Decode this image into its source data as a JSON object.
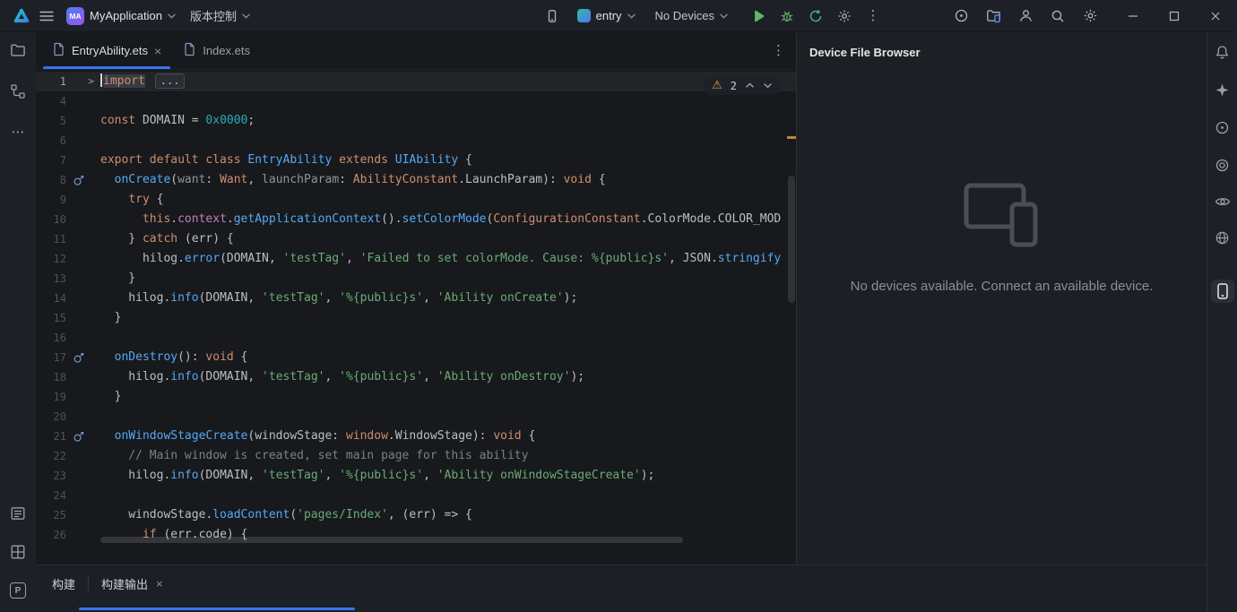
{
  "titlebar": {
    "project_badge": "MA",
    "project_name": "MyApplication",
    "vcs_label": "版本控制",
    "run_config_label": "entry",
    "device_selector_label": "No Devices"
  },
  "editor_tabs": {
    "tabs": [
      {
        "label": "EntryAbility.ets",
        "active": true
      },
      {
        "label": "Index.ets",
        "active": false
      }
    ]
  },
  "editor": {
    "inspection": {
      "warning_count": "2"
    },
    "token_colors": {
      "def": "#bcbec4",
      "kw": "#cf8e6d",
      "fn": "#56a8f5",
      "cls": "#56a8f5",
      "typ": "#cf8e6d",
      "str": "#6aab73",
      "num": "#29abb7",
      "cmt": "#7a8089",
      "fld": "#c77dbb",
      "prm": "#8f949d",
      "fold": "#b6bac2"
    },
    "lines": [
      {
        "n": "1",
        "caret": true,
        "fold": true,
        "tokens": [
          [
            "kw",
            "import",
            "hl"
          ],
          [
            "def",
            " "
          ],
          [
            "fold",
            "..."
          ]
        ]
      },
      {
        "n": "4",
        "tokens": []
      },
      {
        "n": "5",
        "tokens": [
          [
            "kw",
            "const"
          ],
          [
            "def",
            " DOMAIN = "
          ],
          [
            "num",
            "0x0000"
          ],
          [
            "def",
            ";"
          ]
        ]
      },
      {
        "n": "6",
        "tokens": []
      },
      {
        "n": "7",
        "tokens": [
          [
            "kw",
            "export default class "
          ],
          [
            "cls",
            "EntryAbility"
          ],
          [
            "kw",
            " extends "
          ],
          [
            "cls",
            "UIAbility"
          ],
          [
            "def",
            " {"
          ]
        ]
      },
      {
        "n": "8",
        "gutter": "override",
        "tokens": [
          [
            "def",
            "  "
          ],
          [
            "fn",
            "onCreate"
          ],
          [
            "def",
            "("
          ],
          [
            "prm",
            "want"
          ],
          [
            "def",
            ": "
          ],
          [
            "typ",
            "Want"
          ],
          [
            "def",
            ", "
          ],
          [
            "prm",
            "launchParam"
          ],
          [
            "def",
            ": "
          ],
          [
            "typ",
            "AbilityConstant"
          ],
          [
            "def",
            ".LaunchParam): "
          ],
          [
            "kw",
            "void"
          ],
          [
            "def",
            " {"
          ]
        ]
      },
      {
        "n": "9",
        "tokens": [
          [
            "def",
            "    "
          ],
          [
            "kw",
            "try"
          ],
          [
            "def",
            " {"
          ]
        ]
      },
      {
        "n": "10",
        "tokens": [
          [
            "def",
            "      "
          ],
          [
            "kw",
            "this"
          ],
          [
            "def",
            "."
          ],
          [
            "fld",
            "context"
          ],
          [
            "def",
            "."
          ],
          [
            "fn",
            "getApplicationContext"
          ],
          [
            "def",
            "()."
          ],
          [
            "fn",
            "setColorMode"
          ],
          [
            "def",
            "("
          ],
          [
            "typ",
            "ConfigurationConstant"
          ],
          [
            "def",
            ".ColorMode.COLOR_MOD"
          ]
        ]
      },
      {
        "n": "11",
        "tokens": [
          [
            "def",
            "    } "
          ],
          [
            "kw",
            "catch"
          ],
          [
            "def",
            " (err) {"
          ]
        ]
      },
      {
        "n": "12",
        "tokens": [
          [
            "def",
            "      hilog."
          ],
          [
            "fn",
            "error"
          ],
          [
            "def",
            "(DOMAIN, "
          ],
          [
            "str",
            "'testTag'"
          ],
          [
            "def",
            ", "
          ],
          [
            "str",
            "'Failed to set colorMode. Cause: %{public}s'"
          ],
          [
            "def",
            ", JSON."
          ],
          [
            "fn",
            "stringify"
          ]
        ]
      },
      {
        "n": "13",
        "tokens": [
          [
            "def",
            "    }"
          ]
        ]
      },
      {
        "n": "14",
        "tokens": [
          [
            "def",
            "    hilog."
          ],
          [
            "fn",
            "info"
          ],
          [
            "def",
            "(DOMAIN, "
          ],
          [
            "str",
            "'testTag'"
          ],
          [
            "def",
            ", "
          ],
          [
            "str",
            "'%{public}s'"
          ],
          [
            "def",
            ", "
          ],
          [
            "str",
            "'Ability onCreate'"
          ],
          [
            "def",
            ");"
          ]
        ]
      },
      {
        "n": "15",
        "tokens": [
          [
            "def",
            "  }"
          ]
        ]
      },
      {
        "n": "16",
        "tokens": []
      },
      {
        "n": "17",
        "gutter": "override",
        "tokens": [
          [
            "def",
            "  "
          ],
          [
            "fn",
            "onDestroy"
          ],
          [
            "def",
            "(): "
          ],
          [
            "kw",
            "void"
          ],
          [
            "def",
            " {"
          ]
        ]
      },
      {
        "n": "18",
        "tokens": [
          [
            "def",
            "    hilog."
          ],
          [
            "fn",
            "info"
          ],
          [
            "def",
            "(DOMAIN, "
          ],
          [
            "str",
            "'testTag'"
          ],
          [
            "def",
            ", "
          ],
          [
            "str",
            "'%{public}s'"
          ],
          [
            "def",
            ", "
          ],
          [
            "str",
            "'Ability onDestroy'"
          ],
          [
            "def",
            ");"
          ]
        ]
      },
      {
        "n": "19",
        "tokens": [
          [
            "def",
            "  }"
          ]
        ]
      },
      {
        "n": "20",
        "tokens": []
      },
      {
        "n": "21",
        "gutter": "override",
        "tokens": [
          [
            "def",
            "  "
          ],
          [
            "fn",
            "onWindowStageCreate"
          ],
          [
            "def",
            "(windowStage: "
          ],
          [
            "typ",
            "window"
          ],
          [
            "def",
            ".WindowStage): "
          ],
          [
            "kw",
            "void"
          ],
          [
            "def",
            " {"
          ]
        ]
      },
      {
        "n": "22",
        "tokens": [
          [
            "cmt",
            "    // Main window is created, set main page for this ability"
          ]
        ]
      },
      {
        "n": "23",
        "tokens": [
          [
            "def",
            "    hilog."
          ],
          [
            "fn",
            "info"
          ],
          [
            "def",
            "(DOMAIN, "
          ],
          [
            "str",
            "'testTag'"
          ],
          [
            "def",
            ", "
          ],
          [
            "str",
            "'%{public}s'"
          ],
          [
            "def",
            ", "
          ],
          [
            "str",
            "'Ability onWindowStageCreate'"
          ],
          [
            "def",
            ");"
          ]
        ]
      },
      {
        "n": "24",
        "tokens": []
      },
      {
        "n": "25",
        "tokens": [
          [
            "def",
            "    windowStage."
          ],
          [
            "fn",
            "loadContent"
          ],
          [
            "def",
            "("
          ],
          [
            "str",
            "'pages/Index'"
          ],
          [
            "def",
            ", (err) => {"
          ]
        ]
      },
      {
        "n": "26",
        "tokens": [
          [
            "def",
            "      "
          ],
          [
            "kw",
            "if"
          ],
          [
            "def",
            " (err.code) {"
          ]
        ]
      }
    ]
  },
  "device_panel": {
    "title": "Device File Browser",
    "empty_message": "No devices available. Connect an available device."
  },
  "bottom_bar": {
    "build_label": "构建",
    "build_output_tab": "构建输出"
  },
  "colors": {
    "accent_blue": "#3574f0",
    "run_green": "#5cb85f",
    "warning_yellow": "#d9a344",
    "scroll_mark_orange": "#b9863c"
  },
  "icons": {
    "logo-icon": "teal-gradient-triangle",
    "menu-icon": "hamburger",
    "chevron-down-icon": "chevron-down",
    "device-icon": "phone-outline",
    "run-icon": "green-play-triangle",
    "debug-icon": "green-bug",
    "profile-icon": "teal-circular-arrow",
    "run-settings-icon": "gear",
    "more-icon": "⋮",
    "record-icon": "circle-dot",
    "device-folder-icon": "folder-with-phone",
    "account-icon": "person",
    "search-icon": "magnifier",
    "settings-icon": "gear",
    "minimize-icon": "line",
    "maximize-icon": "square",
    "close-icon": "×",
    "project-icon": "folder",
    "structure-icon": "linked-squares",
    "more-tools-icon": "⋯",
    "build-tool-icon": "panel-list",
    "grid-icon": "window-grid",
    "problems-icon": "P",
    "notifications-icon": "bell",
    "ai-assistant-icon": "sparkle",
    "target-icon": "circle-dot",
    "rings-icon": "concentric-circles",
    "previewer-icon": "eye",
    "globe-icon": "globe",
    "device-file-browser-icon": "phone",
    "warning-icon": "⚠",
    "fold-icon": ">",
    "override-icon": "circle-up-arrow",
    "file-icon": "document"
  }
}
